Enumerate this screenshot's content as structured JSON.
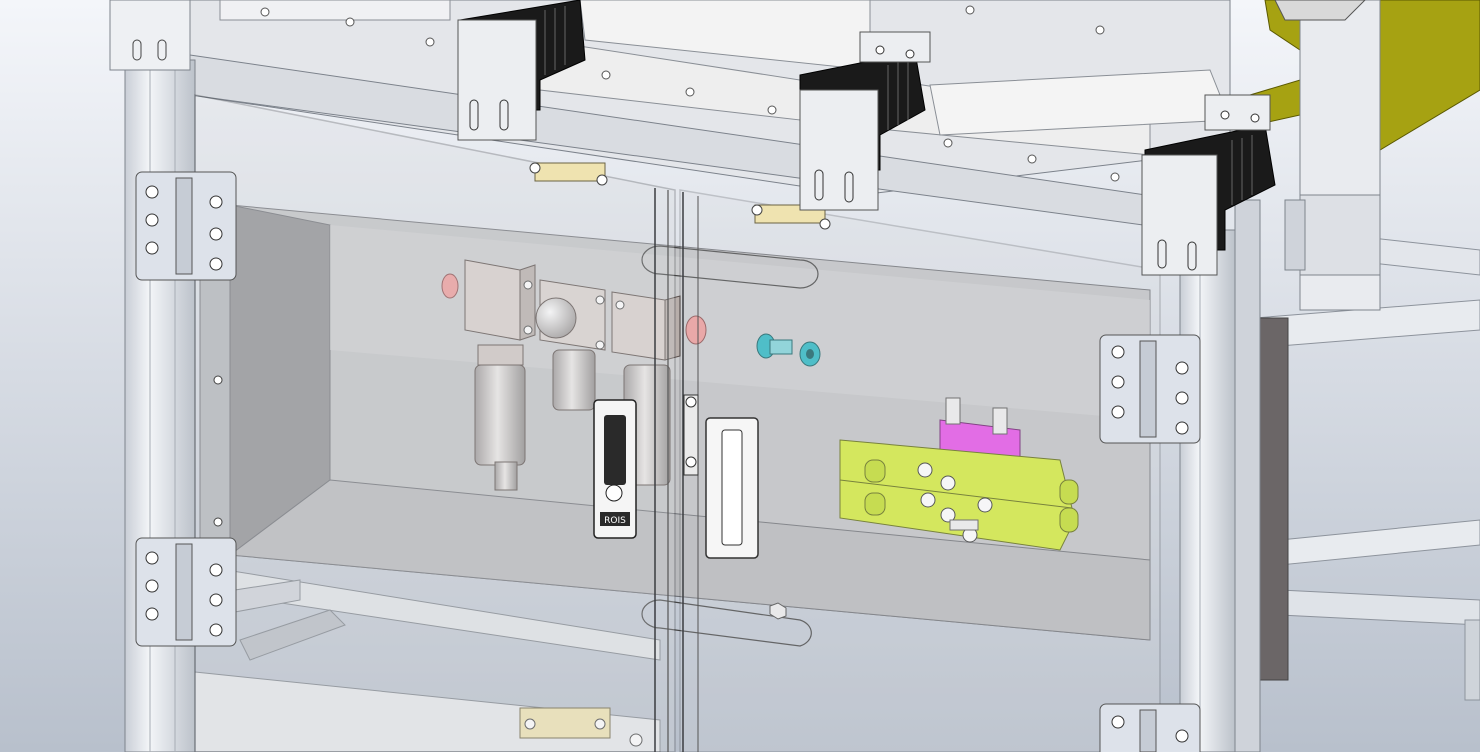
{
  "scene": {
    "background_top": "#f4f6fa",
    "background_bottom": "#b8c0cc",
    "colors": {
      "profile": "#e6e9ee",
      "profile_dark": "#b9bfc8",
      "black_bracket": "#1a1a1a",
      "panel": "#c3c4c6",
      "glass": "#d8dadd",
      "olive": "#a6a212",
      "valve_green": "#d4ec3a",
      "valve_magenta": "#e64ee8",
      "fitting_teal": "#29b7c2",
      "fitting_pink": "#ef9a9a",
      "hinge": "#dde2ea",
      "label_tan": "#efe3b0"
    },
    "parts": [
      {
        "name": "aluminum-frame",
        "kind": "structure"
      },
      {
        "name": "electrical-cabinet-glass-doors",
        "kind": "enclosure"
      },
      {
        "name": "door-hinges",
        "count": 5
      },
      {
        "name": "air-filter-regulator-unit",
        "kind": "pneumatic"
      },
      {
        "name": "door-lock-handle",
        "kind": "hardware",
        "badge_text": "ROIS"
      },
      {
        "name": "door-pull-handle",
        "kind": "hardware"
      },
      {
        "name": "solenoid-valve-manifold",
        "kind": "pneumatic"
      },
      {
        "name": "quick-connect-fitting",
        "kind": "pneumatic"
      },
      {
        "name": "black-cable-brackets",
        "count": 3
      },
      {
        "name": "olive-mounting-plates",
        "count": 2
      }
    ]
  }
}
